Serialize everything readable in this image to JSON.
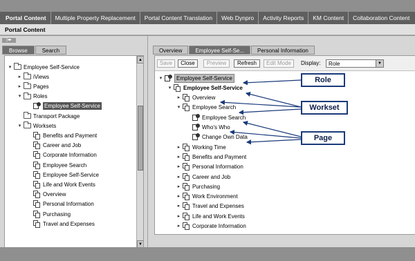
{
  "top_nav": [
    "Portal Content",
    "Multiple Property Replacement",
    "Portal Content Translation",
    "Web Dynpro",
    "Activity Reports",
    "KM Content",
    "Collaboration Content"
  ],
  "page_title": "Portal Content",
  "left": {
    "tabs": [
      "Browse",
      "Search"
    ],
    "tree": [
      {
        "label": "Employee Self-Service",
        "toggle": "▾",
        "icon": "folder-icon"
      },
      {
        "label": "iViews",
        "toggle": "▸",
        "icon": "folder-icon"
      },
      {
        "label": "Pages",
        "toggle": "▸",
        "icon": "folder-icon"
      },
      {
        "label": "Roles",
        "toggle": "▾",
        "icon": "folder-icon"
      },
      {
        "label": "Employee Self-Service",
        "toggle": "",
        "icon": "role-icon"
      },
      {
        "label": "Transport Package",
        "toggle": "",
        "icon": "folder-icon"
      },
      {
        "label": "Worksets",
        "toggle": "▾",
        "icon": "folder-icon"
      },
      {
        "label": "Benefits and Payment",
        "toggle": "",
        "icon": "page-icon"
      },
      {
        "label": "Career and Job",
        "toggle": "",
        "icon": "page-icon"
      },
      {
        "label": "Corporate Information",
        "toggle": "",
        "icon": "page-icon"
      },
      {
        "label": "Employee Search",
        "toggle": "",
        "icon": "page-icon"
      },
      {
        "label": "Employee Self-Service",
        "toggle": "",
        "icon": "page-icon"
      },
      {
        "label": "Life and Work Events",
        "toggle": "",
        "icon": "page-icon"
      },
      {
        "label": "Overview",
        "toggle": "",
        "icon": "page-icon"
      },
      {
        "label": "Personal Information",
        "toggle": "",
        "icon": "page-icon"
      },
      {
        "label": "Purchasing",
        "toggle": "",
        "icon": "page-icon"
      },
      {
        "label": "Travel and Expenses",
        "toggle": "",
        "icon": "page-icon"
      }
    ]
  },
  "right": {
    "tabs": [
      "Overview",
      "Employee Self-Se...",
      "Personal Information"
    ],
    "toolbar": {
      "save": "Save",
      "close": "Close",
      "preview": "Preview",
      "refresh": "Refresh",
      "edit_mode": "Edit Mode",
      "display_label": "Display:",
      "display_value": "Role"
    },
    "tree": [
      {
        "label": "Employee Self-Service",
        "toggle": "▾",
        "icon": "role-icon"
      },
      {
        "label": "Employee Self-Service",
        "toggle": "▾",
        "icon": "page-icon"
      },
      {
        "label": "Overview",
        "toggle": "▸",
        "icon": "page-icon"
      },
      {
        "label": "Employee Search",
        "toggle": "▾",
        "icon": "page-icon"
      },
      {
        "label": "Employee Search",
        "toggle": "",
        "icon": "role-icon"
      },
      {
        "label": "Who's Who",
        "toggle": "",
        "icon": "role-icon"
      },
      {
        "label": "Change Own Data",
        "toggle": "",
        "icon": "role-icon"
      },
      {
        "label": "Working Time",
        "toggle": "▸",
        "icon": "page-icon"
      },
      {
        "label": "Benefits and Payment",
        "toggle": "▸",
        "icon": "page-icon"
      },
      {
        "label": "Personal Information",
        "toggle": "▸",
        "icon": "page-icon"
      },
      {
        "label": "Career and Job",
        "toggle": "▸",
        "icon": "page-icon"
      },
      {
        "label": "Purchasing",
        "toggle": "▸",
        "icon": "page-icon"
      },
      {
        "label": "Work Environment",
        "toggle": "▸",
        "icon": "page-icon"
      },
      {
        "label": "Travel and Expenses",
        "toggle": "▸",
        "icon": "page-icon"
      },
      {
        "label": "Life and Work Events",
        "toggle": "▸",
        "icon": "page-icon"
      },
      {
        "label": "Corporate Information",
        "toggle": "▸",
        "icon": "page-icon"
      }
    ]
  },
  "callouts": {
    "role": "Role",
    "workset": "Workset",
    "page": "Page"
  },
  "colors": {
    "callout_border": "#1a3a7a",
    "arrow": "#1a3a7a",
    "nav_bg": "#5f5f5f"
  }
}
